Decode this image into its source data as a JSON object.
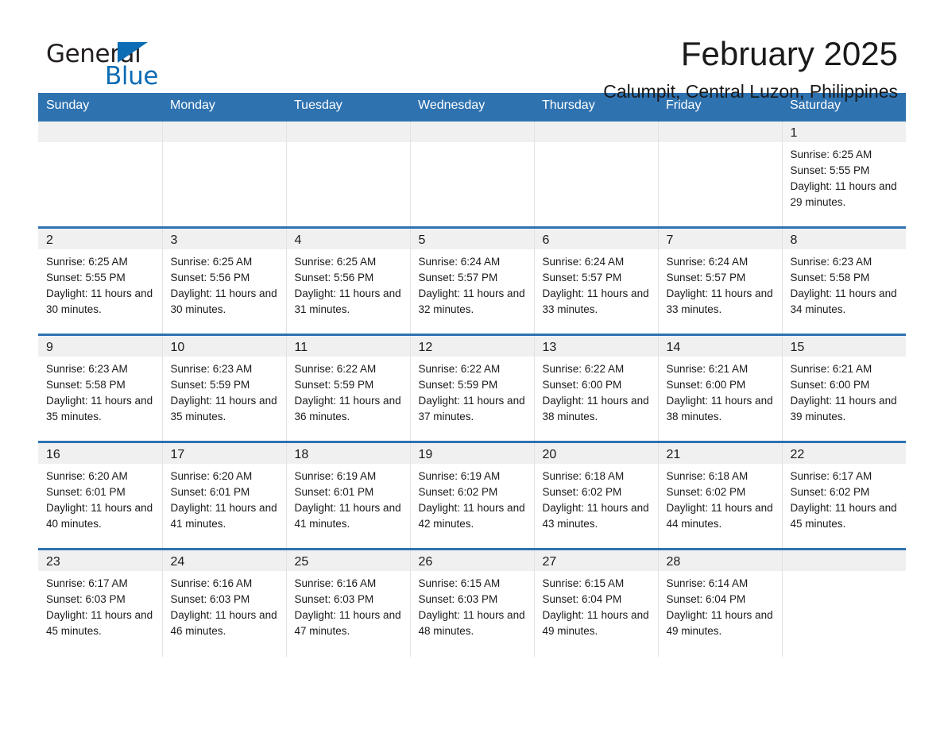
{
  "logo": {
    "word_one": "General",
    "word_two": "Blue",
    "triangle_icon": "triangle-logo-icon",
    "brand_blue": "#0c6cb4"
  },
  "header": {
    "title": "February 2025",
    "subtitle": "Calumpit, Central Luzon, Philippines"
  },
  "theme": {
    "header_blue": "#2e72b0",
    "daynum_bg": "#f0f0f0",
    "cell_bg": "#ffffff",
    "text": "#1a1a1a"
  },
  "calendar": {
    "weekday_headers": [
      "Sunday",
      "Monday",
      "Tuesday",
      "Wednesday",
      "Thursday",
      "Friday",
      "Saturday"
    ],
    "weeks": [
      [
        {
          "day": "",
          "blank": true,
          "sunrise": "",
          "sunset": "",
          "daylight": ""
        },
        {
          "day": "",
          "blank": true,
          "sunrise": "",
          "sunset": "",
          "daylight": ""
        },
        {
          "day": "",
          "blank": true,
          "sunrise": "",
          "sunset": "",
          "daylight": ""
        },
        {
          "day": "",
          "blank": true,
          "sunrise": "",
          "sunset": "",
          "daylight": ""
        },
        {
          "day": "",
          "blank": true,
          "sunrise": "",
          "sunset": "",
          "daylight": ""
        },
        {
          "day": "",
          "blank": true,
          "sunrise": "",
          "sunset": "",
          "daylight": ""
        },
        {
          "day": "1",
          "blank": false,
          "sunrise": "Sunrise: 6:25 AM",
          "sunset": "Sunset: 5:55 PM",
          "daylight": "Daylight: 11 hours and 29 minutes."
        }
      ],
      [
        {
          "day": "2",
          "blank": false,
          "sunrise": "Sunrise: 6:25 AM",
          "sunset": "Sunset: 5:55 PM",
          "daylight": "Daylight: 11 hours and 30 minutes."
        },
        {
          "day": "3",
          "blank": false,
          "sunrise": "Sunrise: 6:25 AM",
          "sunset": "Sunset: 5:56 PM",
          "daylight": "Daylight: 11 hours and 30 minutes."
        },
        {
          "day": "4",
          "blank": false,
          "sunrise": "Sunrise: 6:25 AM",
          "sunset": "Sunset: 5:56 PM",
          "daylight": "Daylight: 11 hours and 31 minutes."
        },
        {
          "day": "5",
          "blank": false,
          "sunrise": "Sunrise: 6:24 AM",
          "sunset": "Sunset: 5:57 PM",
          "daylight": "Daylight: 11 hours and 32 minutes."
        },
        {
          "day": "6",
          "blank": false,
          "sunrise": "Sunrise: 6:24 AM",
          "sunset": "Sunset: 5:57 PM",
          "daylight": "Daylight: 11 hours and 33 minutes."
        },
        {
          "day": "7",
          "blank": false,
          "sunrise": "Sunrise: 6:24 AM",
          "sunset": "Sunset: 5:57 PM",
          "daylight": "Daylight: 11 hours and 33 minutes."
        },
        {
          "day": "8",
          "blank": false,
          "sunrise": "Sunrise: 6:23 AM",
          "sunset": "Sunset: 5:58 PM",
          "daylight": "Daylight: 11 hours and 34 minutes."
        }
      ],
      [
        {
          "day": "9",
          "blank": false,
          "sunrise": "Sunrise: 6:23 AM",
          "sunset": "Sunset: 5:58 PM",
          "daylight": "Daylight: 11 hours and 35 minutes."
        },
        {
          "day": "10",
          "blank": false,
          "sunrise": "Sunrise: 6:23 AM",
          "sunset": "Sunset: 5:59 PM",
          "daylight": "Daylight: 11 hours and 35 minutes."
        },
        {
          "day": "11",
          "blank": false,
          "sunrise": "Sunrise: 6:22 AM",
          "sunset": "Sunset: 5:59 PM",
          "daylight": "Daylight: 11 hours and 36 minutes."
        },
        {
          "day": "12",
          "blank": false,
          "sunrise": "Sunrise: 6:22 AM",
          "sunset": "Sunset: 5:59 PM",
          "daylight": "Daylight: 11 hours and 37 minutes."
        },
        {
          "day": "13",
          "blank": false,
          "sunrise": "Sunrise: 6:22 AM",
          "sunset": "Sunset: 6:00 PM",
          "daylight": "Daylight: 11 hours and 38 minutes."
        },
        {
          "day": "14",
          "blank": false,
          "sunrise": "Sunrise: 6:21 AM",
          "sunset": "Sunset: 6:00 PM",
          "daylight": "Daylight: 11 hours and 38 minutes."
        },
        {
          "day": "15",
          "blank": false,
          "sunrise": "Sunrise: 6:21 AM",
          "sunset": "Sunset: 6:00 PM",
          "daylight": "Daylight: 11 hours and 39 minutes."
        }
      ],
      [
        {
          "day": "16",
          "blank": false,
          "sunrise": "Sunrise: 6:20 AM",
          "sunset": "Sunset: 6:01 PM",
          "daylight": "Daylight: 11 hours and 40 minutes."
        },
        {
          "day": "17",
          "blank": false,
          "sunrise": "Sunrise: 6:20 AM",
          "sunset": "Sunset: 6:01 PM",
          "daylight": "Daylight: 11 hours and 41 minutes."
        },
        {
          "day": "18",
          "blank": false,
          "sunrise": "Sunrise: 6:19 AM",
          "sunset": "Sunset: 6:01 PM",
          "daylight": "Daylight: 11 hours and 41 minutes."
        },
        {
          "day": "19",
          "blank": false,
          "sunrise": "Sunrise: 6:19 AM",
          "sunset": "Sunset: 6:02 PM",
          "daylight": "Daylight: 11 hours and 42 minutes."
        },
        {
          "day": "20",
          "blank": false,
          "sunrise": "Sunrise: 6:18 AM",
          "sunset": "Sunset: 6:02 PM",
          "daylight": "Daylight: 11 hours and 43 minutes."
        },
        {
          "day": "21",
          "blank": false,
          "sunrise": "Sunrise: 6:18 AM",
          "sunset": "Sunset: 6:02 PM",
          "daylight": "Daylight: 11 hours and 44 minutes."
        },
        {
          "day": "22",
          "blank": false,
          "sunrise": "Sunrise: 6:17 AM",
          "sunset": "Sunset: 6:02 PM",
          "daylight": "Daylight: 11 hours and 45 minutes."
        }
      ],
      [
        {
          "day": "23",
          "blank": false,
          "sunrise": "Sunrise: 6:17 AM",
          "sunset": "Sunset: 6:03 PM",
          "daylight": "Daylight: 11 hours and 45 minutes."
        },
        {
          "day": "24",
          "blank": false,
          "sunrise": "Sunrise: 6:16 AM",
          "sunset": "Sunset: 6:03 PM",
          "daylight": "Daylight: 11 hours and 46 minutes."
        },
        {
          "day": "25",
          "blank": false,
          "sunrise": "Sunrise: 6:16 AM",
          "sunset": "Sunset: 6:03 PM",
          "daylight": "Daylight: 11 hours and 47 minutes."
        },
        {
          "day": "26",
          "blank": false,
          "sunrise": "Sunrise: 6:15 AM",
          "sunset": "Sunset: 6:03 PM",
          "daylight": "Daylight: 11 hours and 48 minutes."
        },
        {
          "day": "27",
          "blank": false,
          "sunrise": "Sunrise: 6:15 AM",
          "sunset": "Sunset: 6:04 PM",
          "daylight": "Daylight: 11 hours and 49 minutes."
        },
        {
          "day": "28",
          "blank": false,
          "sunrise": "Sunrise: 6:14 AM",
          "sunset": "Sunset: 6:04 PM",
          "daylight": "Daylight: 11 hours and 49 minutes."
        },
        {
          "day": "",
          "blank": true,
          "sunrise": "",
          "sunset": "",
          "daylight": ""
        }
      ]
    ]
  }
}
